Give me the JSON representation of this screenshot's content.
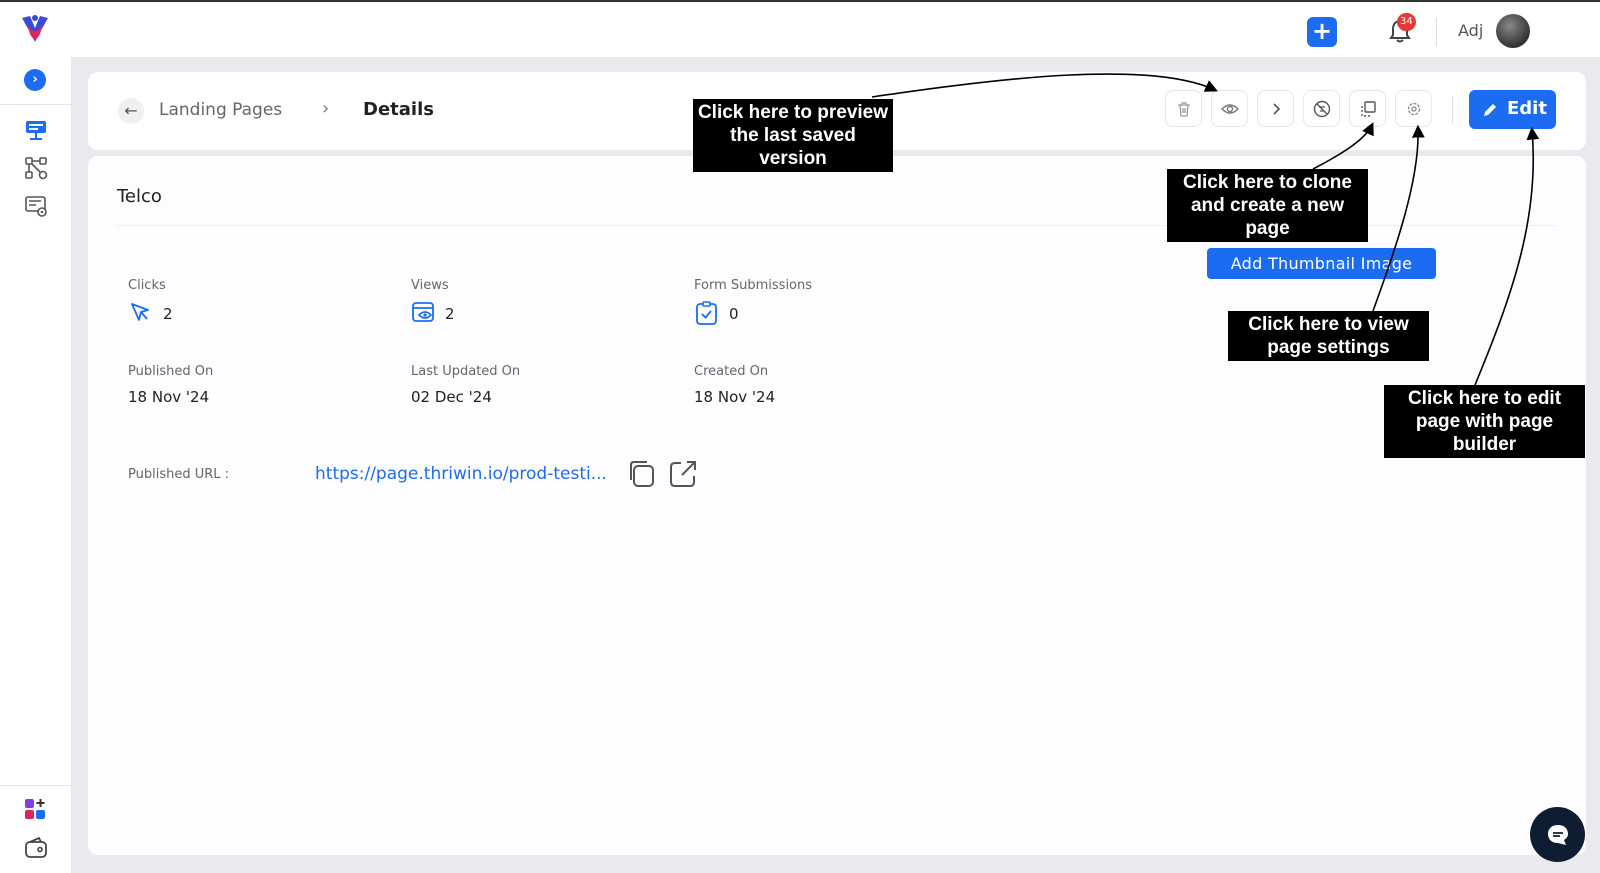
{
  "topbar": {
    "user_name": "Adj",
    "notification_count": "34"
  },
  "breadcrumb": {
    "parent": "Landing Pages",
    "current": "Details"
  },
  "toolbar": {
    "tools": [
      "trash-icon",
      "eye-icon",
      "chevron-right-icon",
      "unpublish-icon",
      "clone-icon",
      "settings-icon"
    ],
    "edit_label": "Edit"
  },
  "page": {
    "name": "Telco"
  },
  "stats": {
    "clicks": {
      "label": "Clicks",
      "value": "2"
    },
    "views": {
      "label": "Views",
      "value": "2"
    },
    "submissions": {
      "label": "Form Submissions",
      "value": "0"
    }
  },
  "dates": {
    "published": {
      "label": "Published On",
      "value": "18 Nov '24"
    },
    "updated": {
      "label": "Last Updated On",
      "value": "02 Dec '24"
    },
    "created": {
      "label": "Created On",
      "value": "18 Nov '24"
    }
  },
  "url": {
    "label": "Published URL :",
    "value": "https://page.thriwin.io/prod-testi..."
  },
  "thumbnail_button": "Add Thumbnail Image",
  "callouts": {
    "preview": "Click here to preview the last saved version",
    "clone": "Click here to clone and create a new page",
    "settings": "Click here to view page settings",
    "edit": "Click here to edit page with page builder"
  },
  "colors": {
    "accent": "#1c6cf2",
    "badge": "#e53935",
    "callout_bg": "#000000"
  }
}
